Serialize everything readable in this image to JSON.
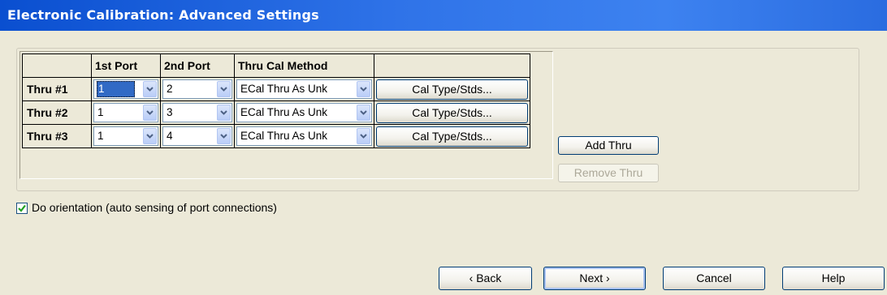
{
  "window": {
    "title": "Electronic Calibration: Advanced Settings"
  },
  "grid": {
    "columns": [
      "1st Port",
      "2nd Port",
      "Thru Cal Method",
      ""
    ],
    "rows": [
      {
        "label": "Thru #1",
        "port1": "1",
        "port2": "2",
        "method": "ECal Thru As Unk",
        "button": "Cal Type/Stds..."
      },
      {
        "label": "Thru #2",
        "port1": "1",
        "port2": "3",
        "method": "ECal Thru As Unk",
        "button": "Cal Type/Stds..."
      },
      {
        "label": "Thru #3",
        "port1": "1",
        "port2": "4",
        "method": "ECal Thru As Unk",
        "button": "Cal Type/Stds..."
      }
    ]
  },
  "actions": {
    "add_thru": "Add Thru",
    "remove_thru": "Remove Thru"
  },
  "orientation": {
    "label": "Do orientation (auto sensing of port connections)",
    "checked": true
  },
  "footer": {
    "back": "‹ Back",
    "next": "Next ›",
    "cancel": "Cancel",
    "help": "Help"
  },
  "colors": {
    "title_bar": "#0a4fd0",
    "dialog_bg": "#ece9d8",
    "selection": "#316ac5",
    "check": "#21a121"
  },
  "icons": {
    "dropdown": "chevron-down-icon",
    "check": "checkmark-icon"
  }
}
